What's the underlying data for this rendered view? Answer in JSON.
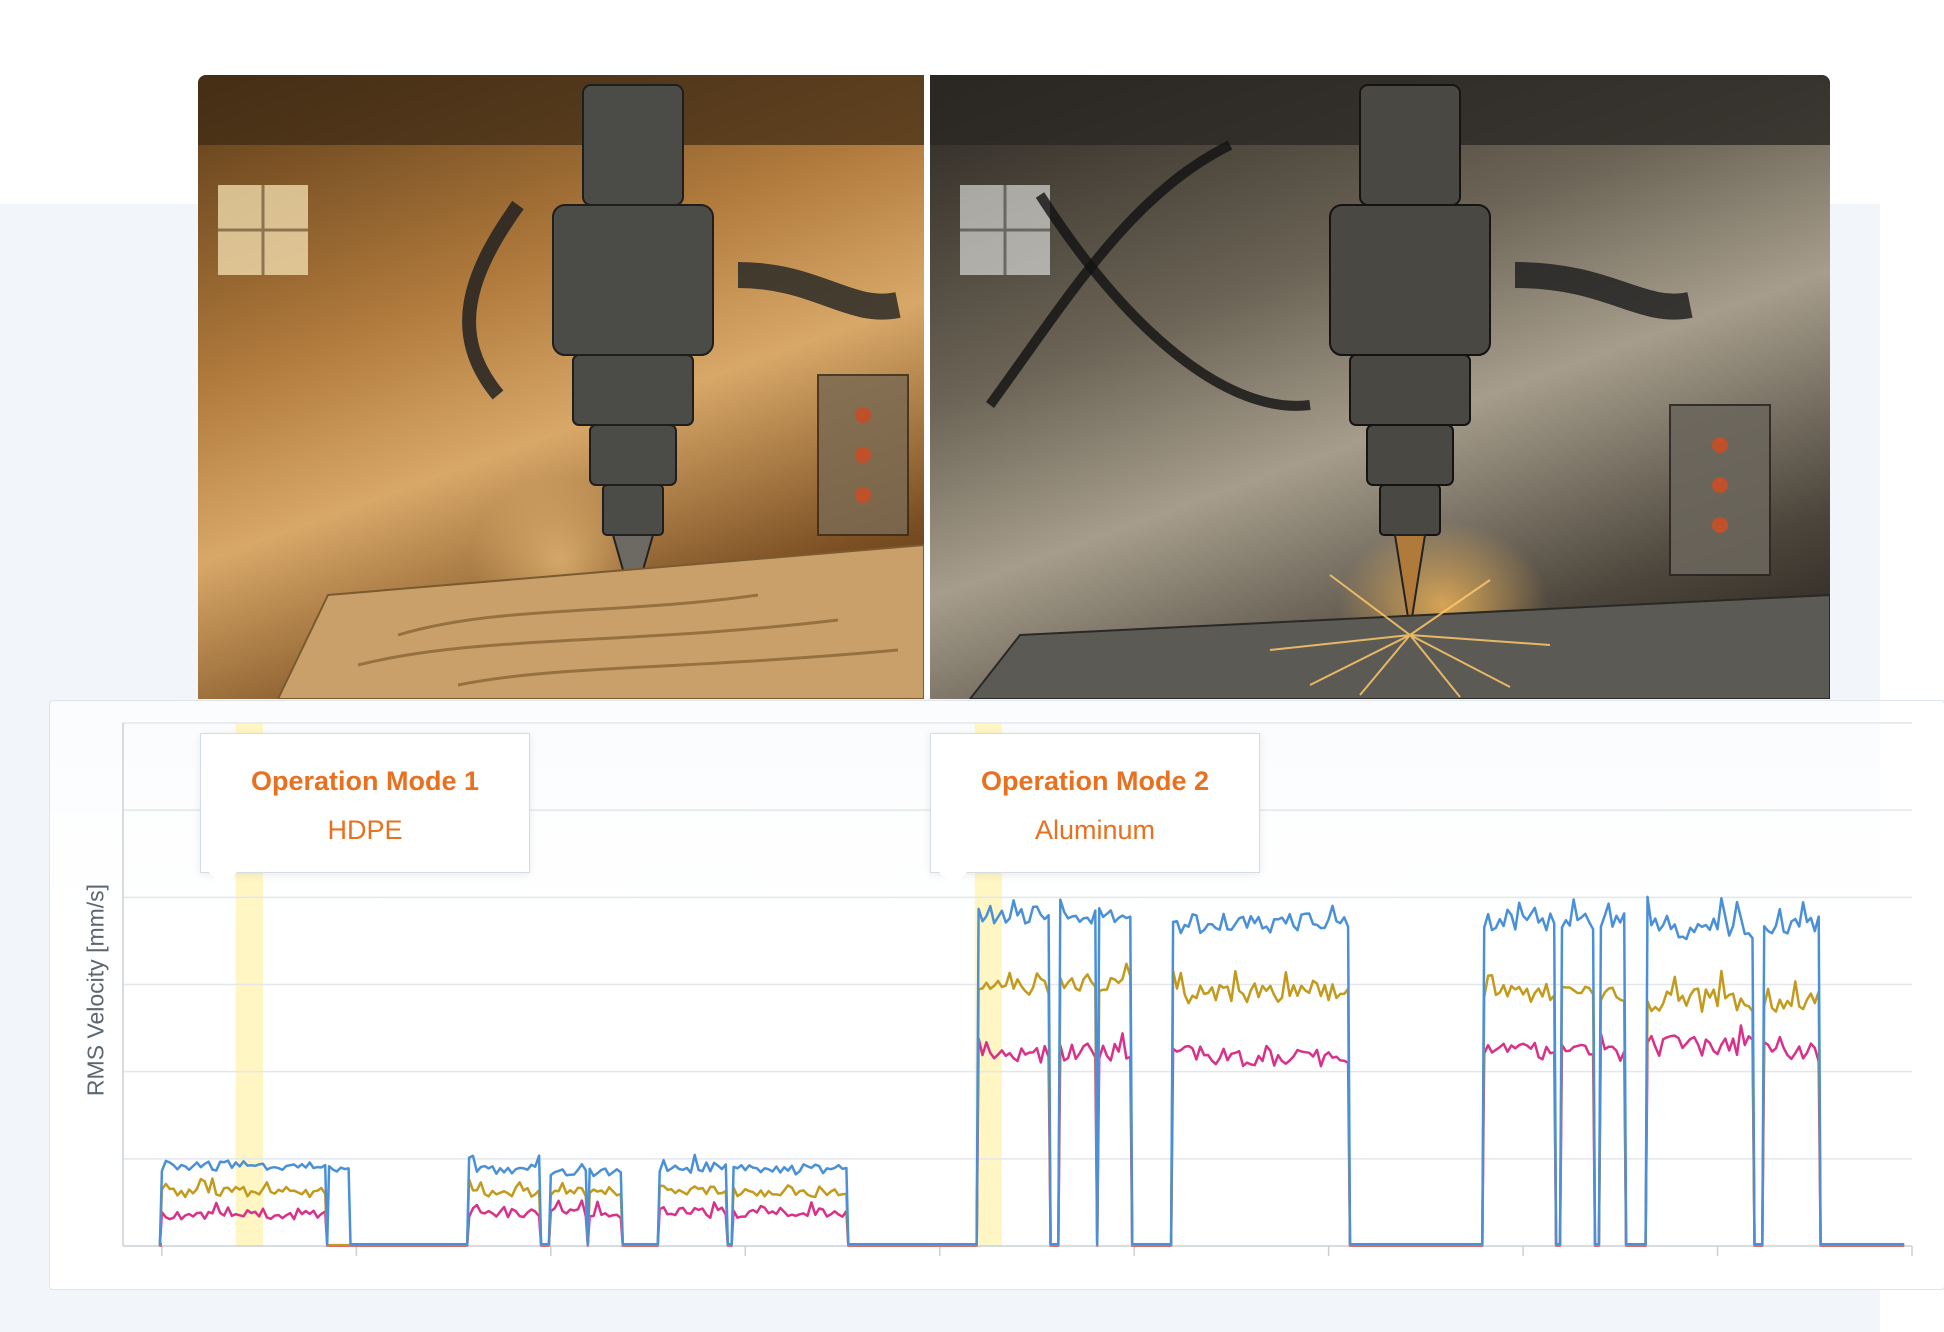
{
  "images": [
    {
      "name": "photo-hdpe-milling",
      "description_icon": "spindle-wood-icon"
    },
    {
      "name": "photo-aluminum-milling",
      "description_icon": "spindle-sparks-icon"
    }
  ],
  "annotations": [
    {
      "title": "Operation Mode 1",
      "subtitle": "HDPE"
    },
    {
      "title": "Operation Mode 2",
      "subtitle": "Aluminum"
    }
  ],
  "colors": {
    "accent": "#e8701e",
    "series_blue": "#4a90d9",
    "series_gold": "#c39a1c",
    "series_pink": "#d9318a",
    "highlight": "#fff6c4",
    "grid": "#e3e7eb"
  },
  "chart_data": {
    "type": "line",
    "title": "",
    "xlabel": "",
    "ylabel": "RMS Velocity [mm/s]",
    "ylim": [
      0,
      6
    ],
    "grid": true,
    "show_tick_labels": false,
    "x_major_ticks": [
      0,
      5,
      10,
      15,
      20,
      25,
      30,
      35,
      40,
      45
    ],
    "segments": [
      {
        "x": [
          0,
          4.2
        ],
        "levels": [
          0.92,
          0.62,
          0.35
        ],
        "noise": 0.06,
        "mode": 1
      },
      {
        "x": [
          4.3,
          4.8
        ],
        "levels": [
          0.88,
          0.0,
          0.0
        ],
        "noise": 0.04,
        "mode": 1
      },
      {
        "x": [
          7.9,
          9.7
        ],
        "levels": [
          0.88,
          0.62,
          0.38
        ],
        "noise": 0.06,
        "mode": 1
      },
      {
        "x": [
          10.0,
          10.9
        ],
        "levels": [
          0.85,
          0.62,
          0.38
        ],
        "noise": 0.06,
        "mode": 1
      },
      {
        "x": [
          11.0,
          11.8
        ],
        "levels": [
          0.85,
          0.62,
          0.38
        ],
        "noise": 0.06,
        "mode": 1
      },
      {
        "x": [
          12.8,
          14.5
        ],
        "levels": [
          0.9,
          0.64,
          0.38
        ],
        "noise": 0.06,
        "mode": 1
      },
      {
        "x": [
          14.7,
          17.6
        ],
        "levels": [
          0.88,
          0.62,
          0.38
        ],
        "noise": 0.06,
        "mode": 1
      },
      {
        "x": [
          21.0,
          22.8
        ],
        "levels": [
          3.8,
          2.98,
          2.2
        ],
        "noise": 0.1,
        "mode": 2
      },
      {
        "x": [
          23.1,
          24.0
        ],
        "levels": [
          3.78,
          3.0,
          2.22
        ],
        "noise": 0.1,
        "mode": 2
      },
      {
        "x": [
          24.1,
          24.9
        ],
        "levels": [
          3.78,
          3.0,
          2.22
        ],
        "noise": 0.1,
        "mode": 2
      },
      {
        "x": [
          26.0,
          30.5
        ],
        "levels": [
          3.7,
          2.9,
          2.18
        ],
        "noise": 0.12,
        "mode": 2
      },
      {
        "x": [
          34.0,
          35.8
        ],
        "levels": [
          3.72,
          2.9,
          2.22
        ],
        "noise": 0.1,
        "mode": 2
      },
      {
        "x": [
          36.0,
          36.8
        ],
        "levels": [
          3.72,
          2.9,
          2.22
        ],
        "noise": 0.1,
        "mode": 2
      },
      {
        "x": [
          37.0,
          37.6
        ],
        "levels": [
          3.72,
          2.9,
          2.22
        ],
        "noise": 0.1,
        "mode": 2
      },
      {
        "x": [
          38.2,
          40.9
        ],
        "levels": [
          3.65,
          2.82,
          2.28
        ],
        "noise": 0.14,
        "mode": 2
      },
      {
        "x": [
          41.2,
          42.6
        ],
        "levels": [
          3.68,
          2.8,
          2.22
        ],
        "noise": 0.12,
        "mode": 2
      }
    ],
    "x_range": [
      -1,
      45
    ],
    "series": [
      {
        "color": "#4a90d9"
      },
      {
        "color": "#c39a1c"
      },
      {
        "color": "#d9318a"
      }
    ],
    "highlights": [
      {
        "x": [
          1.9,
          2.6
        ]
      },
      {
        "x": [
          20.9,
          21.6
        ]
      }
    ]
  }
}
